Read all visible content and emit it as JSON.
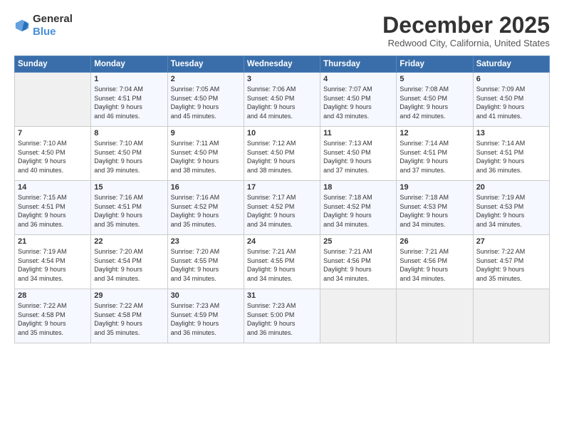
{
  "logo": {
    "general": "General",
    "blue": "Blue"
  },
  "title": "December 2025",
  "subtitle": "Redwood City, California, United States",
  "days_header": [
    "Sunday",
    "Monday",
    "Tuesday",
    "Wednesday",
    "Thursday",
    "Friday",
    "Saturday"
  ],
  "weeks": [
    [
      {
        "num": "",
        "info": ""
      },
      {
        "num": "1",
        "info": "Sunrise: 7:04 AM\nSunset: 4:51 PM\nDaylight: 9 hours\nand 46 minutes."
      },
      {
        "num": "2",
        "info": "Sunrise: 7:05 AM\nSunset: 4:50 PM\nDaylight: 9 hours\nand 45 minutes."
      },
      {
        "num": "3",
        "info": "Sunrise: 7:06 AM\nSunset: 4:50 PM\nDaylight: 9 hours\nand 44 minutes."
      },
      {
        "num": "4",
        "info": "Sunrise: 7:07 AM\nSunset: 4:50 PM\nDaylight: 9 hours\nand 43 minutes."
      },
      {
        "num": "5",
        "info": "Sunrise: 7:08 AM\nSunset: 4:50 PM\nDaylight: 9 hours\nand 42 minutes."
      },
      {
        "num": "6",
        "info": "Sunrise: 7:09 AM\nSunset: 4:50 PM\nDaylight: 9 hours\nand 41 minutes."
      }
    ],
    [
      {
        "num": "7",
        "info": "Sunrise: 7:10 AM\nSunset: 4:50 PM\nDaylight: 9 hours\nand 40 minutes."
      },
      {
        "num": "8",
        "info": "Sunrise: 7:10 AM\nSunset: 4:50 PM\nDaylight: 9 hours\nand 39 minutes."
      },
      {
        "num": "9",
        "info": "Sunrise: 7:11 AM\nSunset: 4:50 PM\nDaylight: 9 hours\nand 38 minutes."
      },
      {
        "num": "10",
        "info": "Sunrise: 7:12 AM\nSunset: 4:50 PM\nDaylight: 9 hours\nand 38 minutes."
      },
      {
        "num": "11",
        "info": "Sunrise: 7:13 AM\nSunset: 4:50 PM\nDaylight: 9 hours\nand 37 minutes."
      },
      {
        "num": "12",
        "info": "Sunrise: 7:14 AM\nSunset: 4:51 PM\nDaylight: 9 hours\nand 37 minutes."
      },
      {
        "num": "13",
        "info": "Sunrise: 7:14 AM\nSunset: 4:51 PM\nDaylight: 9 hours\nand 36 minutes."
      }
    ],
    [
      {
        "num": "14",
        "info": "Sunrise: 7:15 AM\nSunset: 4:51 PM\nDaylight: 9 hours\nand 36 minutes."
      },
      {
        "num": "15",
        "info": "Sunrise: 7:16 AM\nSunset: 4:51 PM\nDaylight: 9 hours\nand 35 minutes."
      },
      {
        "num": "16",
        "info": "Sunrise: 7:16 AM\nSunset: 4:52 PM\nDaylight: 9 hours\nand 35 minutes."
      },
      {
        "num": "17",
        "info": "Sunrise: 7:17 AM\nSunset: 4:52 PM\nDaylight: 9 hours\nand 34 minutes."
      },
      {
        "num": "18",
        "info": "Sunrise: 7:18 AM\nSunset: 4:52 PM\nDaylight: 9 hours\nand 34 minutes."
      },
      {
        "num": "19",
        "info": "Sunrise: 7:18 AM\nSunset: 4:53 PM\nDaylight: 9 hours\nand 34 minutes."
      },
      {
        "num": "20",
        "info": "Sunrise: 7:19 AM\nSunset: 4:53 PM\nDaylight: 9 hours\nand 34 minutes."
      }
    ],
    [
      {
        "num": "21",
        "info": "Sunrise: 7:19 AM\nSunset: 4:54 PM\nDaylight: 9 hours\nand 34 minutes."
      },
      {
        "num": "22",
        "info": "Sunrise: 7:20 AM\nSunset: 4:54 PM\nDaylight: 9 hours\nand 34 minutes."
      },
      {
        "num": "23",
        "info": "Sunrise: 7:20 AM\nSunset: 4:55 PM\nDaylight: 9 hours\nand 34 minutes."
      },
      {
        "num": "24",
        "info": "Sunrise: 7:21 AM\nSunset: 4:55 PM\nDaylight: 9 hours\nand 34 minutes."
      },
      {
        "num": "25",
        "info": "Sunrise: 7:21 AM\nSunset: 4:56 PM\nDaylight: 9 hours\nand 34 minutes."
      },
      {
        "num": "26",
        "info": "Sunrise: 7:21 AM\nSunset: 4:56 PM\nDaylight: 9 hours\nand 34 minutes."
      },
      {
        "num": "27",
        "info": "Sunrise: 7:22 AM\nSunset: 4:57 PM\nDaylight: 9 hours\nand 35 minutes."
      }
    ],
    [
      {
        "num": "28",
        "info": "Sunrise: 7:22 AM\nSunset: 4:58 PM\nDaylight: 9 hours\nand 35 minutes."
      },
      {
        "num": "29",
        "info": "Sunrise: 7:22 AM\nSunset: 4:58 PM\nDaylight: 9 hours\nand 35 minutes."
      },
      {
        "num": "30",
        "info": "Sunrise: 7:23 AM\nSunset: 4:59 PM\nDaylight: 9 hours\nand 36 minutes."
      },
      {
        "num": "31",
        "info": "Sunrise: 7:23 AM\nSunset: 5:00 PM\nDaylight: 9 hours\nand 36 minutes."
      },
      {
        "num": "",
        "info": ""
      },
      {
        "num": "",
        "info": ""
      },
      {
        "num": "",
        "info": ""
      }
    ]
  ]
}
